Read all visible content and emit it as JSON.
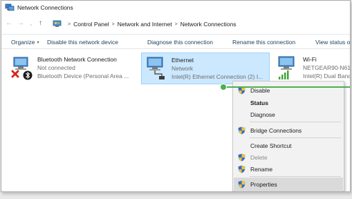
{
  "window": {
    "title": "Network Connections"
  },
  "address": {
    "back_glyph": "←",
    "forward_glyph": "→",
    "dropdown_glyph": "⌄",
    "up_glyph": "↑",
    "separator_glyph": ">",
    "crumbs": [
      "Control Panel",
      "Network and Internet",
      "Network Connections"
    ]
  },
  "toolbar": {
    "organize": "Organize",
    "organize_caret": "▾",
    "disable": "Disable this network device",
    "diagnose": "Diagnose this connection",
    "rename": "Rename this connection",
    "view_status": "View status o"
  },
  "connections": {
    "bluetooth": {
      "name": "Bluetooth Network Connection",
      "status": "Not connected",
      "device": "Bluetooth Device (Personal Area ..."
    },
    "ethernet": {
      "name": "Ethernet",
      "status": "Network",
      "device": "Intel(R) Ethernet Connection (2) I..."
    },
    "wifi": {
      "name": "Wi-Fi",
      "status": "NETGEAR90-N61",
      "device": "Intel(R) Dual Band"
    }
  },
  "context_menu": {
    "disable": "Disable",
    "status": "Status",
    "diagnose": "Diagnose",
    "bridge": "Bridge Connections",
    "shortcut": "Create Shortcut",
    "delete": "Delete",
    "rename": "Rename",
    "properties": "Properties"
  },
  "colors": {
    "selection": "#cce8ff",
    "pointer": "#4caf50",
    "link_text": "#1e3e5c"
  }
}
